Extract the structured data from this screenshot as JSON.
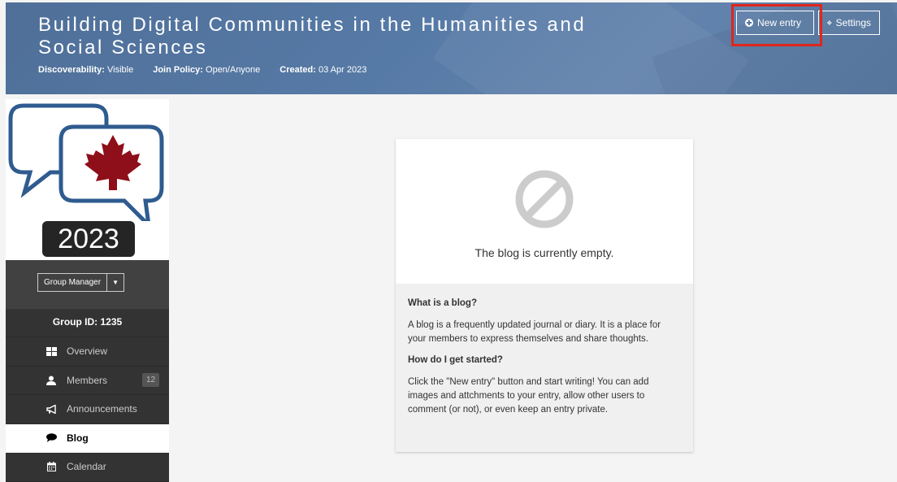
{
  "header": {
    "title": "Building Digital Communities in the Humanities and Social Sciences",
    "meta": [
      {
        "label": "Discoverability:",
        "value": "Visible"
      },
      {
        "label": "Join Policy:",
        "value": "Open/Anyone"
      },
      {
        "label": "Created:",
        "value": "03 Apr 2023"
      }
    ],
    "new_entry_label": "New entry",
    "settings_label": "Settings",
    "highlight_color": "#e0251b"
  },
  "sidebar": {
    "year": "2023",
    "manager_label": "Group Manager",
    "group_id": "Group ID: 1235",
    "items": [
      {
        "label": "Overview",
        "icon": "grid-icon"
      },
      {
        "label": "Members",
        "icon": "user-icon",
        "badge": "12"
      },
      {
        "label": "Announcements",
        "icon": "megaphone-icon"
      },
      {
        "label": "Blog",
        "icon": "speech-bubble-icon",
        "active": true
      },
      {
        "label": "Calendar",
        "icon": "calendar-icon"
      }
    ]
  },
  "empty_state": {
    "message": "The blog is currently empty.",
    "q1": "What is a blog?",
    "a1": "A blog is a frequently updated journal or diary. It is a place for your members to express themselves and share thoughts.",
    "q2": "How do I get started?",
    "a2": "Click the \"New entry\" button and start writing! You can add images and attchments to your entry, allow other users to comment (or not), or even keep an entry private."
  },
  "colors": {
    "header_blue": "#567aa6",
    "sidebar_dark": "#333333",
    "maple_red": "#8e0f19",
    "logo_outline": "#2f5b8f"
  }
}
